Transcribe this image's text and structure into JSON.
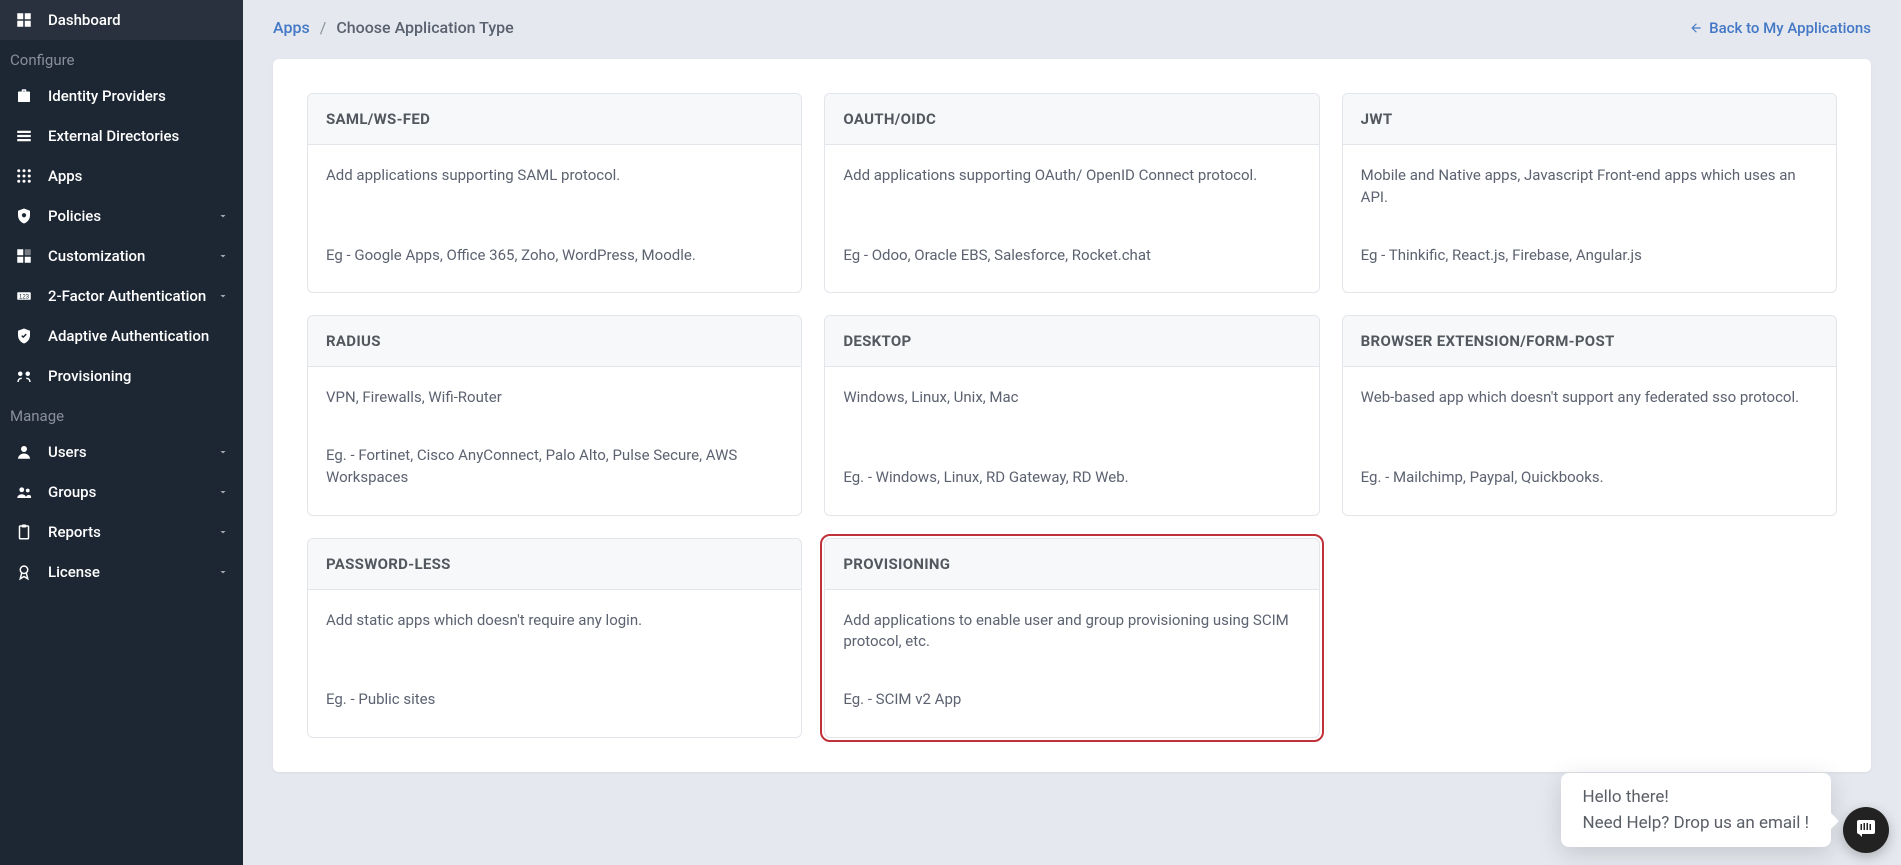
{
  "sidebar": {
    "top": {
      "label": "Dashboard"
    },
    "sec1": "Configure",
    "identity": {
      "label": "Identity Providers"
    },
    "extdir": {
      "label": "External Directories"
    },
    "apps": {
      "label": "Apps"
    },
    "policies": {
      "label": "Policies"
    },
    "custom": {
      "label": "Customization"
    },
    "tfa": {
      "label": "2-Factor Authentication"
    },
    "adaptive": {
      "label": "Adaptive Authentication"
    },
    "prov": {
      "label": "Provisioning"
    },
    "sec2": "Manage",
    "users": {
      "label": "Users"
    },
    "groups": {
      "label": "Groups"
    },
    "reports": {
      "label": "Reports"
    },
    "license": {
      "label": "License"
    }
  },
  "breadcrumb": {
    "root": "Apps",
    "current": "Choose Application Type"
  },
  "back": "Back to My Applications",
  "cards": {
    "saml": {
      "title": "SAML/WS-FED",
      "desc": "Add applications supporting SAML protocol.",
      "ex": "Eg - Google Apps, Office 365, Zoho, WordPress, Moodle."
    },
    "oauth": {
      "title": "OAUTH/OIDC",
      "desc": "Add applications supporting OAuth/ OpenID Connect protocol.",
      "ex": "Eg - Odoo, Oracle EBS, Salesforce, Rocket.chat"
    },
    "jwt": {
      "title": "JWT",
      "desc": "Mobile and Native apps, Javascript Front-end apps which uses an API.",
      "ex": "Eg - Thinkific, React.js, Firebase, Angular.js"
    },
    "radius": {
      "title": "RADIUS",
      "desc": "VPN, Firewalls, Wifi-Router",
      "ex": "Eg. - Fortinet, Cisco AnyConnect, Palo Alto, Pulse Secure, AWS Workspaces"
    },
    "desktop": {
      "title": "DESKTOP",
      "desc": "Windows, Linux, Unix, Mac",
      "ex": "Eg. - Windows, Linux, RD Gateway, RD Web."
    },
    "browser": {
      "title": "BROWSER EXTENSION/FORM-POST",
      "desc": "Web-based app which doesn't support any federated sso protocol.",
      "ex": "Eg. - Mailchimp, Paypal, Quickbooks."
    },
    "pwdless": {
      "title": "PASSWORD-LESS",
      "desc": "Add static apps which doesn't require any login.",
      "ex": "Eg. - Public sites"
    },
    "provcard": {
      "title": "PROVISIONING",
      "desc": "Add applications to enable user and group provisioning using SCIM protocol, etc.",
      "ex": "Eg. - SCIM v2 App"
    }
  },
  "chat": {
    "line1": "Hello there!",
    "line2": "Need Help? Drop us an email !"
  }
}
